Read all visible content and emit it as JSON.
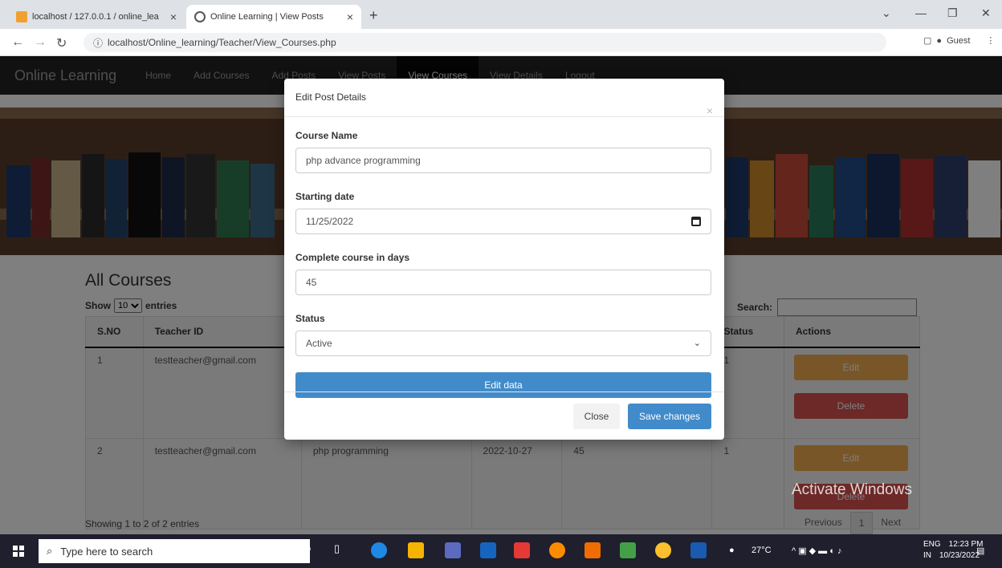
{
  "browser": {
    "tabs": [
      {
        "title": "localhost / 127.0.0.1 / online_lea",
        "active": false
      },
      {
        "title": "Online Learning | View Posts",
        "active": true
      }
    ],
    "url": "localhost/Online_learning/Teacher/View_Courses.php",
    "profile_label": "Guest"
  },
  "site": {
    "brand": "Online Learning",
    "nav": [
      "Home",
      "Add Courses",
      "Add Posts",
      "View Posts",
      "View Courses",
      "View Details",
      "Logout"
    ],
    "active_nav": "View Courses"
  },
  "courses": {
    "heading": "All Courses",
    "show_label": "Show",
    "entries_value": "10",
    "entries_label": "entries",
    "search_label": "Search:",
    "columns": [
      "S.NO",
      "Teacher ID",
      "",
      "",
      "",
      "Status",
      "Actions"
    ],
    "rows": [
      {
        "sno": "1",
        "teacher": "testteacher@gmail.com",
        "c3": "",
        "c4": "",
        "c5": "",
        "status": "1"
      },
      {
        "sno": "2",
        "teacher": "testteacher@gmail.com",
        "c3": "php programming",
        "c4": "2022-10-27",
        "c5": "45",
        "status": "1"
      }
    ],
    "edit_label": "Edit",
    "delete_label": "Delete",
    "showing": "Showing 1 to 2 of 2 entries",
    "pager": {
      "prev": "Previous",
      "page": "1",
      "next": "Next"
    }
  },
  "modal": {
    "title": "Edit Post Details",
    "close_x": "×",
    "fields": {
      "course_name_label": "Course Name",
      "course_name_value": "php advance programming",
      "start_label": "Starting date",
      "start_value": "11/25/2022",
      "days_label": "Complete course in days",
      "days_value": "45",
      "status_label": "Status",
      "status_value": "Active"
    },
    "edit_data_label": "Edit data",
    "close_label": "Close",
    "save_label": "Save changes"
  },
  "watermark": "Activate Windows",
  "taskbar": {
    "search_placeholder": "Type here to search",
    "temperature": "27°C",
    "lang": "ENG",
    "region": "IN",
    "time": "12:23 PM",
    "date": "10/23/2022"
  }
}
